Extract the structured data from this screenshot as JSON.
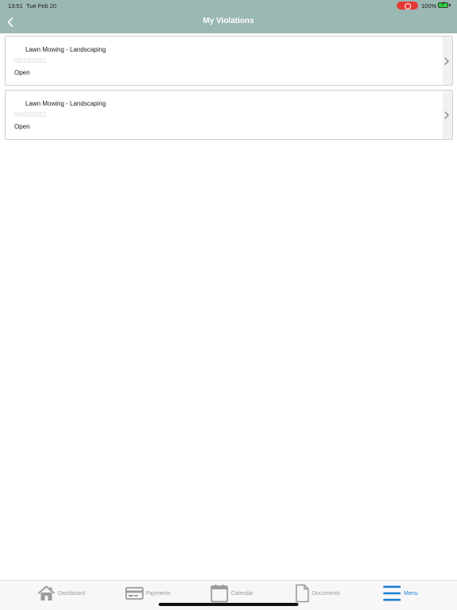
{
  "status_bar": {
    "time": "13:51",
    "date": "Tue Feb 20",
    "battery": "100%"
  },
  "header": {
    "title": "My Violations",
    "background": "#9bb8b3"
  },
  "violations": [
    {
      "title": "Lawn Mowing - Landscaping",
      "date": "05/23/2022",
      "status": "Open"
    },
    {
      "title": "Lawn Mowing - Landscaping",
      "date": "06/02/2022",
      "status": "Open"
    }
  ],
  "tabbar": {
    "active_color": "#1c7fd6",
    "items": [
      {
        "label": "Dashboard",
        "icon": "home-icon"
      },
      {
        "label": "Payments",
        "icon": "card-icon"
      },
      {
        "label": "Calendar",
        "icon": "calendar-icon"
      },
      {
        "label": "Documents",
        "icon": "document-icon"
      },
      {
        "label": "Menu",
        "icon": "menu-icon"
      }
    ]
  }
}
